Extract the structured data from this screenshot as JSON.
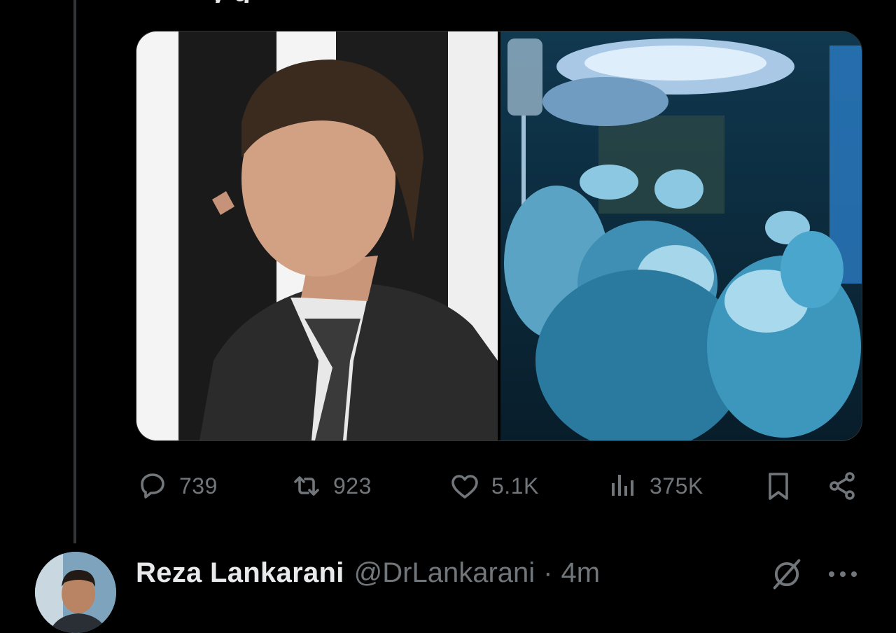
{
  "tweet": {
    "top_text_fragment": "y   g",
    "media": [
      {
        "alt": "Portrait of a man in a dark suit in profile"
      },
      {
        "alt": "Surgeons in blue gowns operating under surgical lights"
      }
    ],
    "actions": {
      "replies": "739",
      "reposts": "923",
      "likes": "5.1K",
      "views": "375K"
    }
  },
  "reply": {
    "author_name": "Reza Lankarani",
    "handle": "@DrLankarani",
    "separator": "·",
    "time": "4m"
  },
  "icons": {
    "reply": "reply-icon",
    "repost": "repost-icon",
    "like": "heart-icon",
    "views": "views-icon",
    "bookmark": "bookmark-icon",
    "share": "share-icon",
    "grok": "grok-icon",
    "more": "more-icon"
  },
  "colors": {
    "background": "#000000",
    "text_primary": "#e7e9ea",
    "text_secondary": "#71767b",
    "thread_line": "#333639"
  }
}
